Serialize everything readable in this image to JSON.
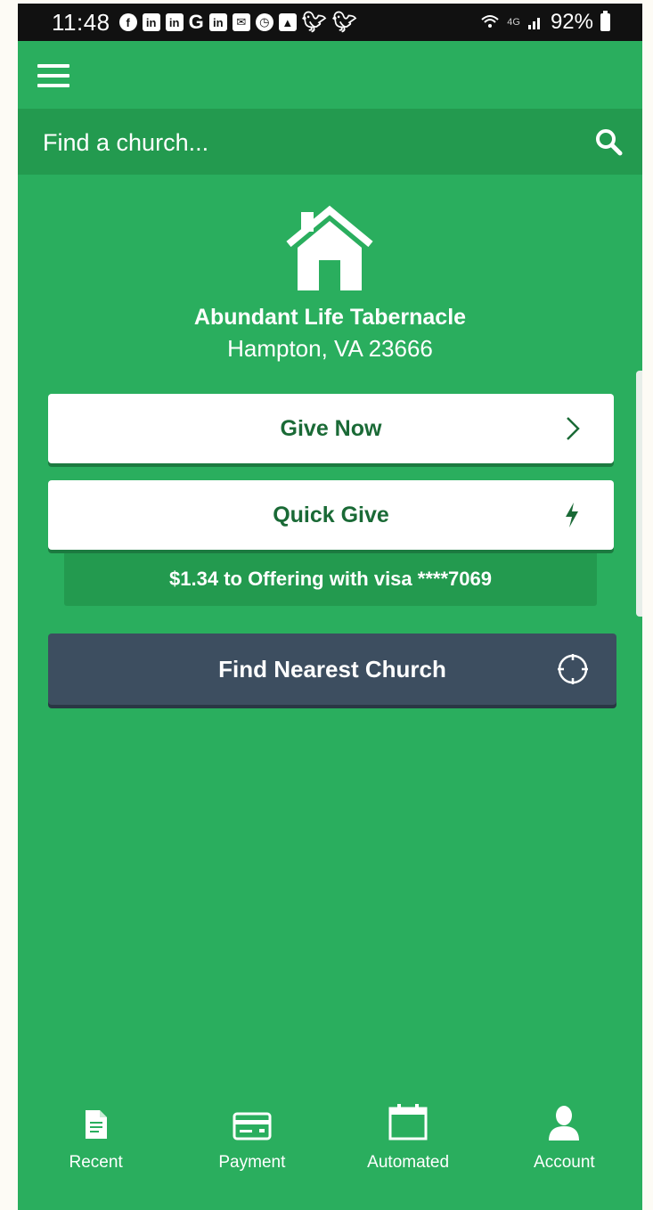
{
  "status_bar": {
    "time": "11:48",
    "notification_icons": [
      "facebook-icon",
      "linkedin-icon",
      "linkedin-icon",
      "google-icon",
      "linkedin-icon",
      "mail-icon",
      "clock-icon",
      "image-icon",
      "twitter-icon",
      "twitter-icon"
    ],
    "network": "4G",
    "battery": "92%"
  },
  "search": {
    "placeholder": "Find a church..."
  },
  "church": {
    "name": "Abundant Life Tabernacle",
    "location": "Hampton, VA 23666"
  },
  "actions": {
    "give_now": "Give Now",
    "quick_give": "Quick Give",
    "quick_give_detail": "$1.34 to Offering with visa ****7069",
    "find_nearest": "Find Nearest Church"
  },
  "bottom_nav": [
    {
      "label": "Recent",
      "icon": "document-icon"
    },
    {
      "label": "Payment",
      "icon": "credit-card-icon"
    },
    {
      "label": "Automated",
      "icon": "calendar-icon"
    },
    {
      "label": "Account",
      "icon": "user-icon"
    }
  ],
  "colors": {
    "primary_green": "#2aae5e",
    "dark_green": "#239a4f",
    "button_text_green": "#1a6a36",
    "find_button": "#3d4e60"
  }
}
